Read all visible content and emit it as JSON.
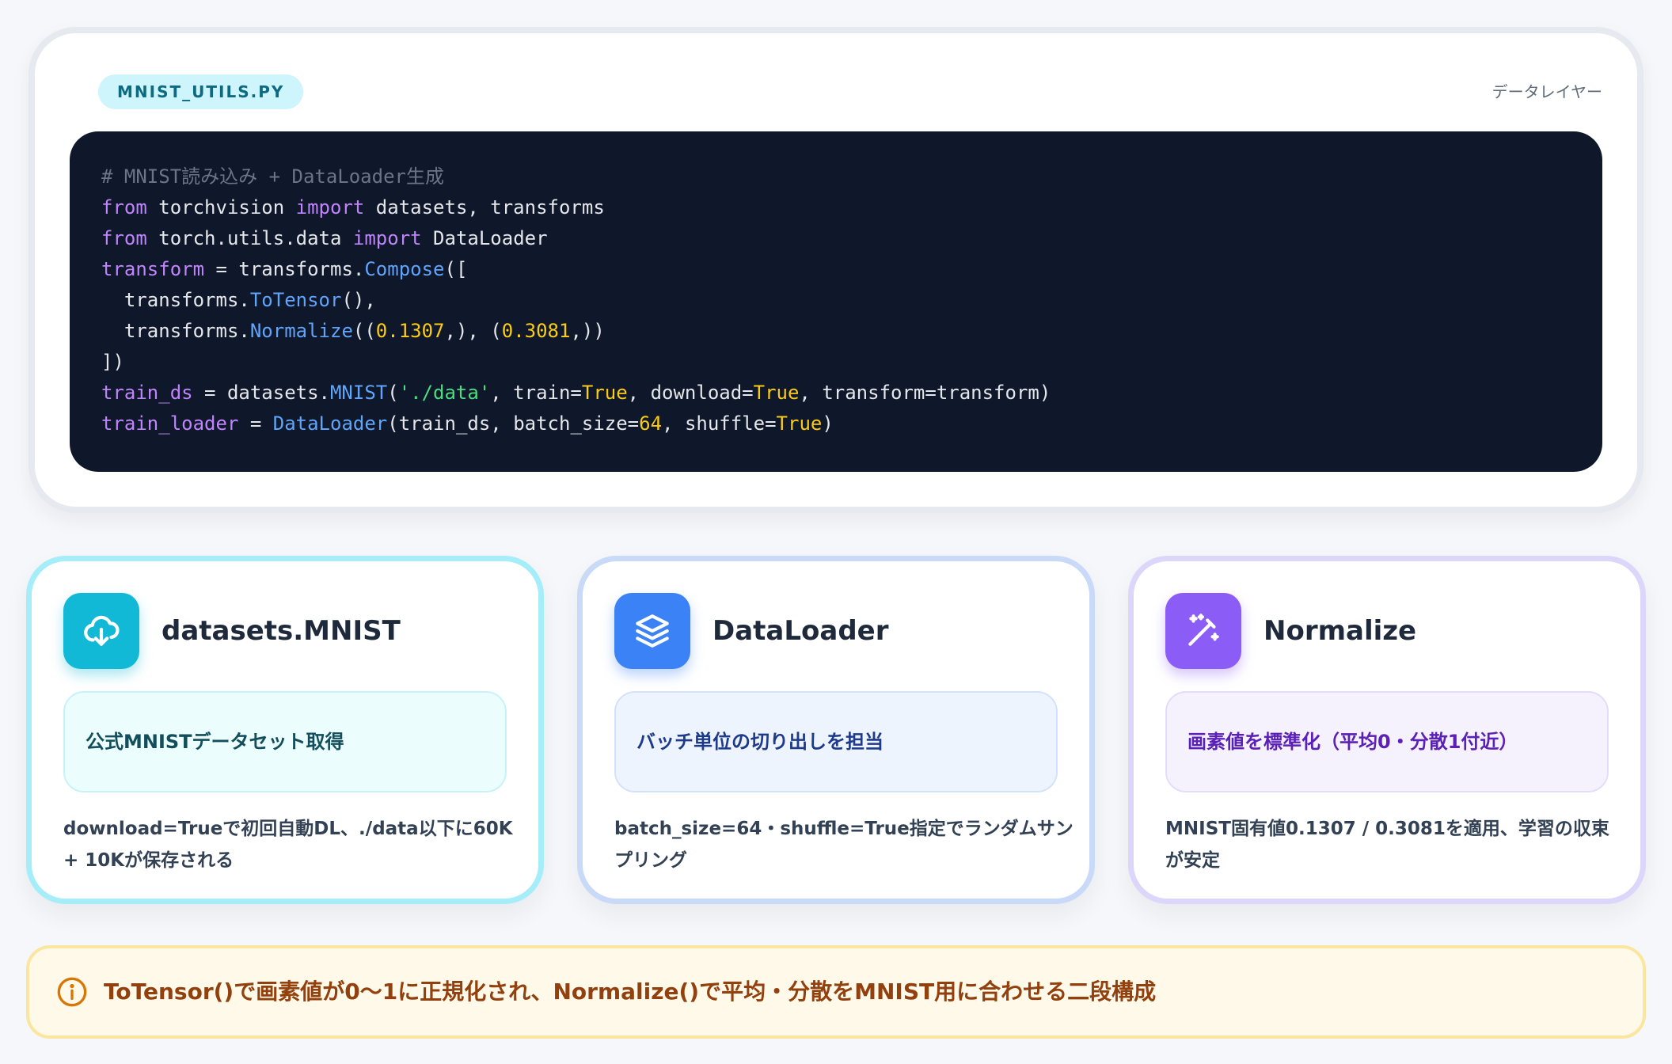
{
  "code_panel": {
    "file_label": "MNIST_UTILS.PY",
    "layer_label": "データレイヤー",
    "lines": [
      [
        {
          "t": "com",
          "v": "# MNIST読み込み + DataLoader生成"
        }
      ],
      [
        {
          "t": "kw",
          "v": "from"
        },
        {
          "t": "def",
          "v": " torchvision "
        },
        {
          "t": "kw",
          "v": "import"
        },
        {
          "t": "def",
          "v": " datasets, transforms"
        }
      ],
      [
        {
          "t": "kw",
          "v": "from"
        },
        {
          "t": "def",
          "v": " torch.utils.data "
        },
        {
          "t": "kw",
          "v": "import"
        },
        {
          "t": "def",
          "v": " DataLoader"
        }
      ],
      [
        {
          "t": "var",
          "v": "transform"
        },
        {
          "t": "def",
          "v": " = transforms."
        },
        {
          "t": "fn",
          "v": "Compose"
        },
        {
          "t": "def",
          "v": "(["
        }
      ],
      [
        {
          "t": "def",
          "v": "  transforms."
        },
        {
          "t": "fn",
          "v": "ToTensor"
        },
        {
          "t": "def",
          "v": "(),"
        }
      ],
      [
        {
          "t": "def",
          "v": "  transforms."
        },
        {
          "t": "fn",
          "v": "Normalize"
        },
        {
          "t": "def",
          "v": "(("
        },
        {
          "t": "num",
          "v": "0.1307"
        },
        {
          "t": "def",
          "v": ",), ("
        },
        {
          "t": "num",
          "v": "0.3081"
        },
        {
          "t": "def",
          "v": ",))"
        }
      ],
      [
        {
          "t": "def",
          "v": "])"
        }
      ],
      [
        {
          "t": "var",
          "v": "train_ds"
        },
        {
          "t": "def",
          "v": " = datasets."
        },
        {
          "t": "fn",
          "v": "MNIST"
        },
        {
          "t": "def",
          "v": "("
        },
        {
          "t": "str",
          "v": "'./data'"
        },
        {
          "t": "def",
          "v": ", train="
        },
        {
          "t": "bool",
          "v": "True"
        },
        {
          "t": "def",
          "v": ", download="
        },
        {
          "t": "bool",
          "v": "True"
        },
        {
          "t": "def",
          "v": ", transform=transform)"
        }
      ],
      [
        {
          "t": "var",
          "v": "train_loader"
        },
        {
          "t": "def",
          "v": " = "
        },
        {
          "t": "fn",
          "v": "DataLoader"
        },
        {
          "t": "def",
          "v": "(train_ds, batch_size="
        },
        {
          "t": "num",
          "v": "64"
        },
        {
          "t": "def",
          "v": ", shuffle="
        },
        {
          "t": "bool",
          "v": "True"
        },
        {
          "t": "def",
          "v": ")"
        }
      ]
    ]
  },
  "cards": [
    {
      "title": "datasets.MNIST",
      "icon": "cloud-download-icon",
      "summary": "公式MNISTデータセット取得",
      "description": "download=Trueで初回自動DL、./data以下に60K + 10Kが保存される"
    },
    {
      "title": "DataLoader",
      "icon": "layers-icon",
      "summary": "バッチ単位の切り出しを担当",
      "description": "batch_size=64・shuffle=True指定でランダムサンプリング"
    },
    {
      "title": "Normalize",
      "icon": "magic-wand-icon",
      "summary": "画素値を標準化（平均0・分散1付近）",
      "description": "MNIST固有値0.1307 / 0.3081を適用、学習の収束が安定"
    }
  ],
  "note": {
    "icon": "info-icon",
    "text": "ToTensor()で画素値が0〜1に正規化され、Normalize()で平均・分散をMNIST用に合わせる二段構成"
  },
  "colors": {
    "code_bg": "#0f172a",
    "cyan": "#12b9d6",
    "blue": "#3b82f6",
    "purple": "#8b5cf6",
    "note_text": "#92400e"
  }
}
